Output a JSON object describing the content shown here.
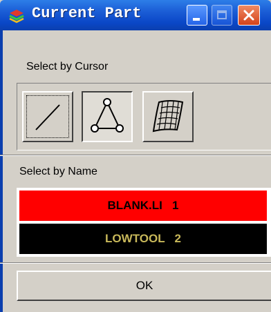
{
  "window": {
    "title": "Current Part",
    "app_icon": "app-layers-icon",
    "controls": [
      "minimize-icon",
      "maximize-icon",
      "close-icon"
    ]
  },
  "select_by_cursor": {
    "label": "Select by Cursor",
    "tools": [
      {
        "icon": "line-icon",
        "pressed": false,
        "focused": true
      },
      {
        "icon": "triangle-nodes-icon",
        "pressed": true,
        "focused": false
      },
      {
        "icon": "surface-mesh-icon",
        "pressed": false,
        "focused": false
      }
    ]
  },
  "select_by_name": {
    "label": "Select by Name",
    "items": [
      {
        "label": "BLANK.LI   1",
        "bg_color": "#ff0000",
        "text_color": "#000000"
      },
      {
        "label": "LOWTOOL   2",
        "bg_color": "#000000",
        "text_color": "#c8b85a"
      }
    ]
  },
  "ok_label": "OK"
}
